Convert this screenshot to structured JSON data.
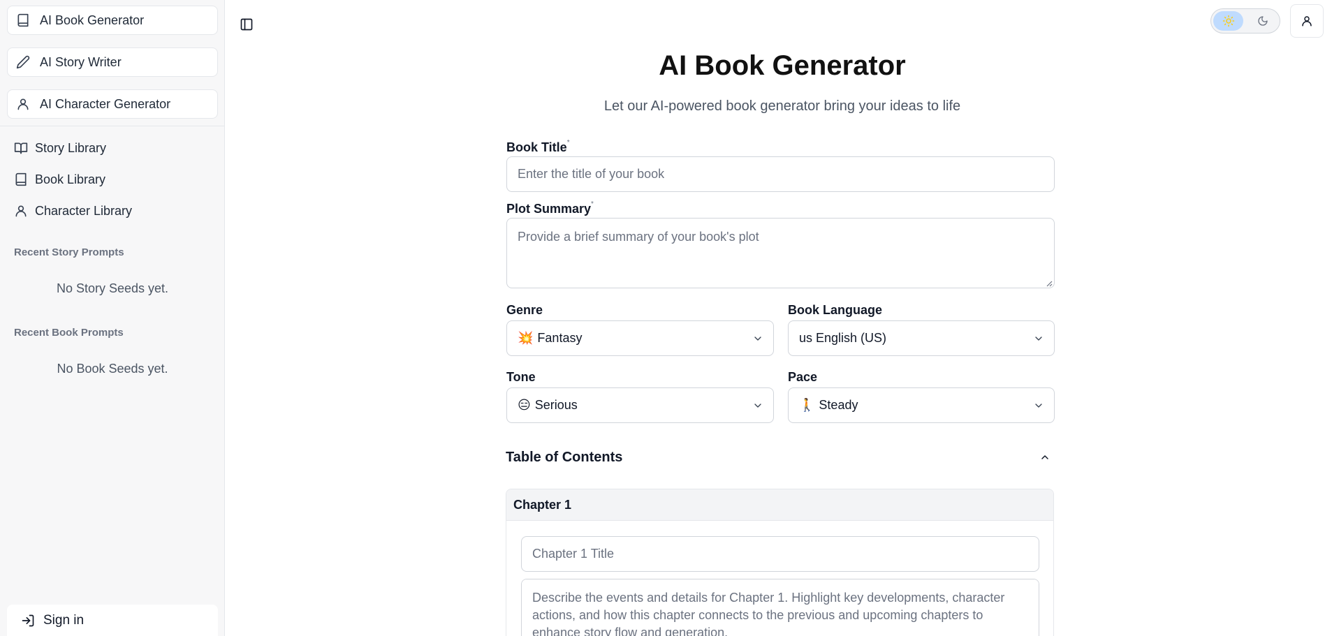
{
  "sidebar": {
    "tools": [
      {
        "label": "AI Book Generator",
        "icon": "book-icon"
      },
      {
        "label": "AI Story Writer",
        "icon": "pencil-icon"
      },
      {
        "label": "AI Character Generator",
        "icon": "user-icon"
      }
    ],
    "libraries": [
      {
        "label": "Story Library",
        "icon": "open-book-icon"
      },
      {
        "label": "Book Library",
        "icon": "book-icon"
      },
      {
        "label": "Character Library",
        "icon": "user-icon"
      }
    ],
    "recent_story_label": "Recent Story Prompts",
    "recent_story_empty": "No Story Seeds yet.",
    "recent_book_label": "Recent Book Prompts",
    "recent_book_empty": "No Book Seeds yet.",
    "signin_label": "Sign in"
  },
  "header": {
    "theme_icons": [
      "sun-icon",
      "moon-icon"
    ],
    "theme_active": "light"
  },
  "main": {
    "title": "AI Book Generator",
    "subtitle": "Let our AI-powered book generator bring your ideas to life",
    "book_title": {
      "label": "Book Title",
      "required_mark": "*",
      "value": "",
      "placeholder": "Enter the title of your book"
    },
    "plot_summary": {
      "label": "Plot Summary",
      "required_mark": "*",
      "value": "",
      "placeholder": "Provide a brief summary of your book's plot"
    },
    "genre": {
      "label": "Genre",
      "emoji": "💥",
      "value": "Fantasy"
    },
    "language": {
      "label": "Book Language",
      "value": "us English (US)"
    },
    "tone": {
      "label": "Tone",
      "emoji": "😑",
      "value": "Serious"
    },
    "pace": {
      "label": "Pace",
      "emoji": "🚶",
      "value": "Steady"
    },
    "toc": {
      "label": "Table of Contents",
      "chapters": [
        {
          "heading": "Chapter 1",
          "title_placeholder": "Chapter 1 Title",
          "desc_placeholder": "Describe the events and details for Chapter 1. Highlight key developments, character actions, and how this chapter connects to the previous and upcoming chapters to enhance story flow and generation."
        }
      ]
    }
  }
}
